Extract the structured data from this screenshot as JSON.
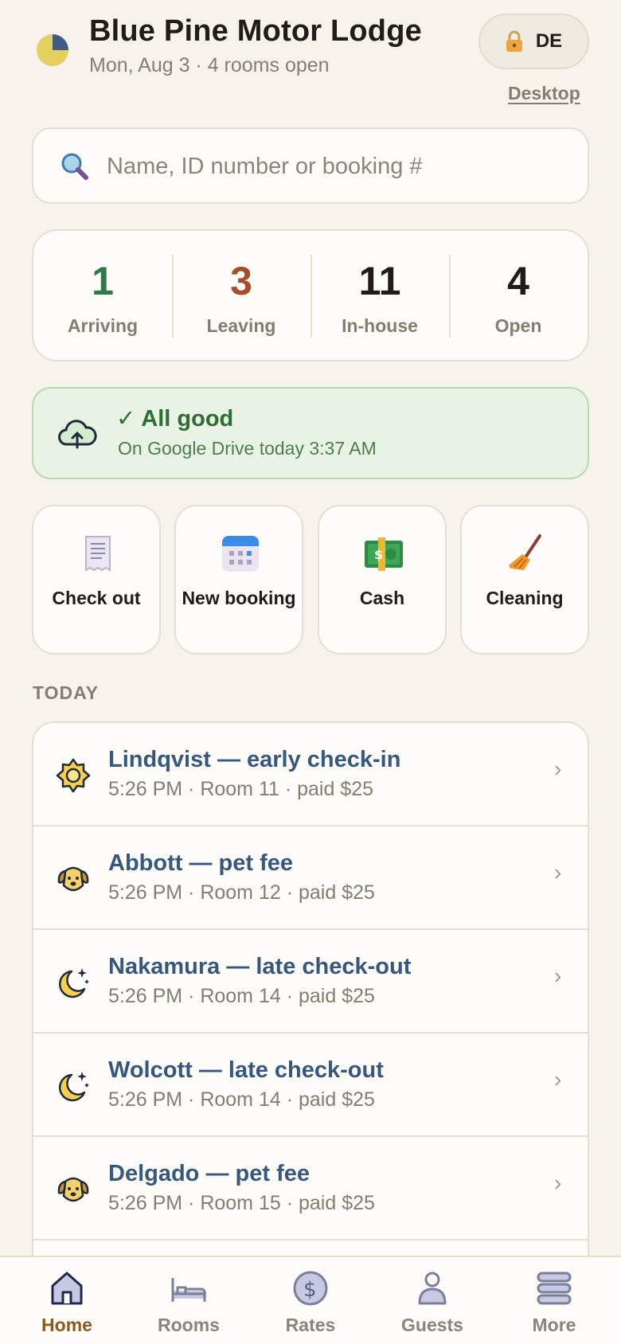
{
  "header": {
    "title": "Blue Pine Motor Lodge",
    "subtitle": "Mon, Aug 3 · 4 rooms open",
    "lock_label": "DE",
    "desktop_link": "Desktop"
  },
  "search": {
    "placeholder": "Name, ID number or booking #",
    "value": ""
  },
  "stats": [
    {
      "value": "1",
      "label": "Arriving",
      "color": "#2e7a45"
    },
    {
      "value": "3",
      "label": "Leaving",
      "color": "#a64e2c"
    },
    {
      "value": "11",
      "label": "In-house",
      "color": "#1f1c19"
    },
    {
      "value": "4",
      "label": "Open",
      "color": "#1f1c19"
    }
  ],
  "sync": {
    "title": "✓ All good",
    "detail": "On Google Drive today 3:37 AM"
  },
  "actions": [
    {
      "label": "Check out",
      "icon": "receipt-icon"
    },
    {
      "label": "New booking",
      "icon": "calendar-icon"
    },
    {
      "label": "Cash",
      "icon": "cash-icon"
    },
    {
      "label": "Cleaning",
      "icon": "broom-icon"
    }
  ],
  "today": {
    "heading": "TODAY",
    "items": [
      {
        "title": "Lindqvist — early check-in",
        "detail": "5:26 PM · Room 11 · paid $25",
        "icon": "sun-icon"
      },
      {
        "title": "Abbott — pet fee",
        "detail": "5:26 PM · Room 12 · paid $25",
        "icon": "dog-icon"
      },
      {
        "title": "Nakamura — late check-out",
        "detail": "5:26 PM · Room 14 · paid $25",
        "icon": "moon-icon"
      },
      {
        "title": "Wolcott — late check-out",
        "detail": "5:26 PM · Room 14 · paid $25",
        "icon": "moon-icon"
      },
      {
        "title": "Delgado — pet fee",
        "detail": "5:26 PM · Room 15 · paid $25",
        "icon": "dog-icon"
      }
    ]
  },
  "nav": [
    {
      "label": "Home",
      "icon": "home-icon",
      "active": true
    },
    {
      "label": "Rooms",
      "icon": "bed-icon",
      "active": false
    },
    {
      "label": "Rates",
      "icon": "dollar-icon",
      "active": false
    },
    {
      "label": "Guests",
      "icon": "guest-icon",
      "active": false
    },
    {
      "label": "More",
      "icon": "more-icon",
      "active": false
    }
  ]
}
